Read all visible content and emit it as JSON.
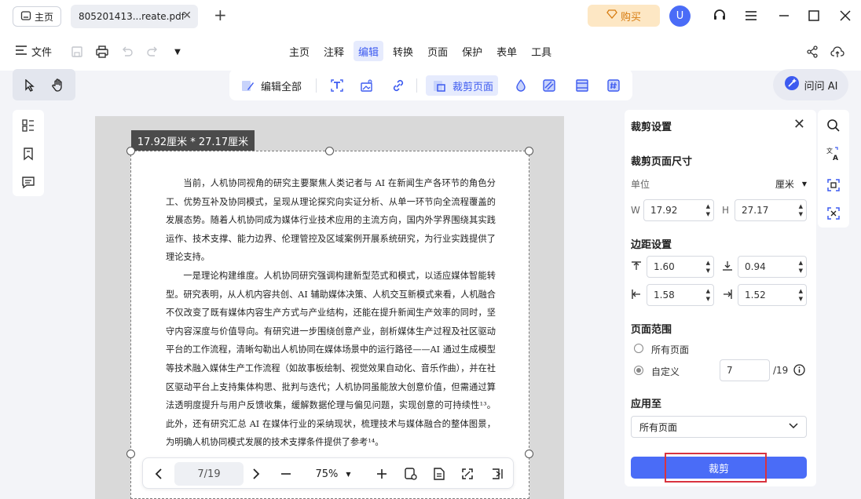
{
  "titlebar": {
    "home_label": "主页",
    "doc_tab_label": "805201413...reate.pdf",
    "buy_label": "购买",
    "avatar_letter": "U"
  },
  "menubar": {
    "file_label": "文件",
    "tabs": [
      {
        "label": "主页",
        "active": false
      },
      {
        "label": "注释",
        "active": false
      },
      {
        "label": "编辑",
        "active": true
      },
      {
        "label": "转换",
        "active": false
      },
      {
        "label": "页面",
        "active": false
      },
      {
        "label": "保护",
        "active": false
      },
      {
        "label": "表单",
        "active": false
      },
      {
        "label": "工具",
        "active": false
      }
    ]
  },
  "edit_toolbar": {
    "edit_all_label": "编辑全部",
    "crop_page_label": "裁剪页面"
  },
  "ai_button_label": "问问 AI",
  "document": {
    "dimensions_label": "17.92厘米 * 27.17厘米",
    "paragraphs": [
      "当前，人机协同视角的研究主要聚焦人类记者与 AI 在新闻生产各环节的角色分工、优势互补及协同模式，呈现从理论探究向实证分析、从单一环节向全流程覆盖的发展态势。随着人机协同成为媒体行业技术应用的主流方向，国内外学界围绕其实践运作、技术支撑、能力边界、伦理管控及区域案例开展系统研究，为行业实践提供了理论支持。",
      "一是理论构建维度。人机协同研究强调构建新型范式和模式，以适应媒体智能转型。研究表明，从人机内容共创、AI 辅助媒体决策、人机交互新模式来看，人机融合不仅改变了既有媒体内容生产方式与产业结构，还能在提升新闻生产效率的同时，坚守内容深度与价值导向。有研究进一步围绕创意产业，剖析媒体生产过程及社区驱动平台的工作流程，清晰勾勒出人机协同在媒体场景中的运行路径——AI 通过生成模型等技术融入媒体生产工作流程（如故事板绘制、视觉效果自动化、音乐作曲），并在社区驱动平台上支持集体构思、批判与迭代；人机协同虽能放大创意价值，但需通过算法透明度提升与用户反馈收集，缓解数据伦理与偏见问题，实现创意的可持续性¹³。此外，还有研究汇总 AI 在媒体行业的采纳现状，梳理技术与媒体融合的整体图景，为明确人机协同模式发展的技术支撑条件提供了参考¹⁴。"
    ]
  },
  "bottom_nav": {
    "page_indicator": "7/19",
    "zoom": "75%"
  },
  "crop_settings": {
    "title": "裁剪设置",
    "page_size_title": "裁剪页面尺寸",
    "unit_label": "单位",
    "unit_value": "厘米",
    "w_label": "W",
    "w_value": "17.92",
    "h_label": "H",
    "h_value": "27.17",
    "margin_title": "边距设置",
    "margin_top": "1.60",
    "margin_bottom": "0.94",
    "margin_left": "1.58",
    "margin_right": "1.52",
    "range_title": "页面范围",
    "range_all_label": "所有页面",
    "range_custom_label": "自定义",
    "range_custom_value": "7",
    "range_total": "/19",
    "apply_title": "应用至",
    "apply_value": "所有页面",
    "crop_button_label": "裁剪"
  },
  "colors": {
    "accent": "#4a6cf7",
    "highlight": "#d9333f",
    "buy_text": "#d77c10"
  }
}
